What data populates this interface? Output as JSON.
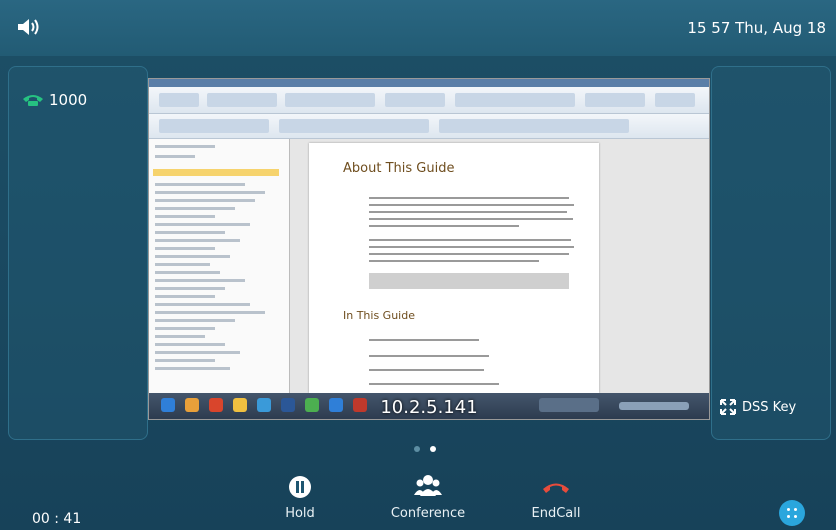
{
  "status_bar": {
    "volume_icon": "speaker-icon",
    "datetime": "15 57 Thu, Aug 18"
  },
  "account": {
    "line_label": "1000",
    "icon": "phone-icon",
    "color": "#26c281"
  },
  "shared_screen": {
    "ip_address": "10.2.5.141",
    "document": {
      "heading": "About This Guide",
      "subheading": "In This Guide"
    }
  },
  "dss": {
    "label": "DSS Key",
    "icon": "expand-icon"
  },
  "page_indicator": {
    "count": 2,
    "active_index": 1
  },
  "call": {
    "duration": "00 : 41"
  },
  "softkeys": [
    {
      "label": "Hold",
      "icon": "pause-icon"
    },
    {
      "label": "Conference",
      "icon": "conference-icon"
    },
    {
      "label": "EndCall",
      "icon": "hangup-icon",
      "color": "#e74c3c"
    }
  ],
  "menu_button": {
    "icon": "grid-dots-icon",
    "color": "#2aa6dd"
  }
}
